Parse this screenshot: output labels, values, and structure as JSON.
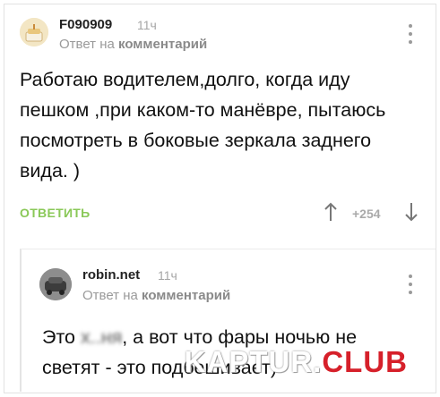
{
  "comment": {
    "username": "F090909",
    "time": "11ч",
    "reply_prefix": "Ответ на",
    "reply_target": "комментарий",
    "text": "Работаю водителем,долго, когда иду пешком ,при каком-то манёвре, пытаюсь посмотреть в боковые зеркала заднего вида. )",
    "reply_label": "ОТВЕТИТЬ",
    "rating": "+254",
    "avatar_icon": "cake-avatar-icon"
  },
  "reply": {
    "username": "robin.net",
    "time": "11ч",
    "reply_prefix": "Ответ на",
    "reply_target": "комментарий",
    "text_part1": "Это ",
    "text_blurred": "х..ня",
    "text_part2": ", а вот что фары ночью не светят - это подбешивает)",
    "avatar_icon": "car-avatar-icon"
  },
  "watermark": {
    "part1": "KAPTUR.",
    "part2": "CLUB"
  },
  "colors": {
    "accent_green": "#8ac858",
    "watermark_red": "#d6202a",
    "muted": "#a6a6a6"
  }
}
